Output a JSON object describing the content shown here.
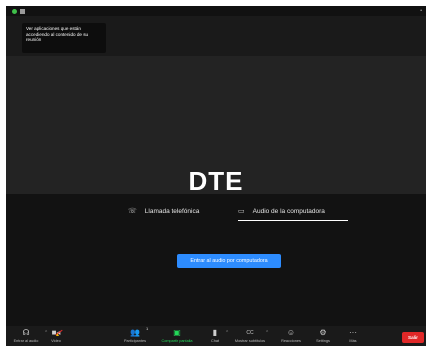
{
  "topbar": {
    "shield_icon": "green-shield-icon",
    "view_icon": "grid-view-icon",
    "right_glyph": "•"
  },
  "tooltip": {
    "text": "Ver aplicaciones que están accediendo al contenido de su reunión"
  },
  "participant": {
    "name": "DTE"
  },
  "audio_panel": {
    "tabs": [
      {
        "label": "Llamada telefónica",
        "icon": "phone-icon"
      },
      {
        "label": "Audio de la computadora",
        "icon": "computer-icon"
      }
    ],
    "selected_tab": "Audio de la computadora",
    "join_button_label": "Entrar al audio por computadora",
    "accent_color": "#2d8cff"
  },
  "toolbar": {
    "items": [
      {
        "label": "Entrar al audio",
        "icon": "headphones-icon"
      },
      {
        "label": "Video",
        "icon": "video-off-icon"
      },
      {
        "label": "Participantes",
        "icon": "participants-icon",
        "count": "1"
      },
      {
        "label": "Compartir pantalla",
        "icon": "share-screen-icon"
      },
      {
        "label": "Chat",
        "icon": "chat-icon"
      },
      {
        "label": "Mostrar subtítulos",
        "icon": "cc-icon",
        "icon_text": "CC"
      },
      {
        "label": "Reacciones",
        "icon": "reactions-icon"
      },
      {
        "label": "Settings",
        "icon": "gear-icon"
      },
      {
        "label": "Más",
        "icon": "more-icon",
        "icon_text": "···"
      }
    ],
    "leave_label": "Salir",
    "leave_color": "#e02828",
    "share_color": "#23d959"
  }
}
